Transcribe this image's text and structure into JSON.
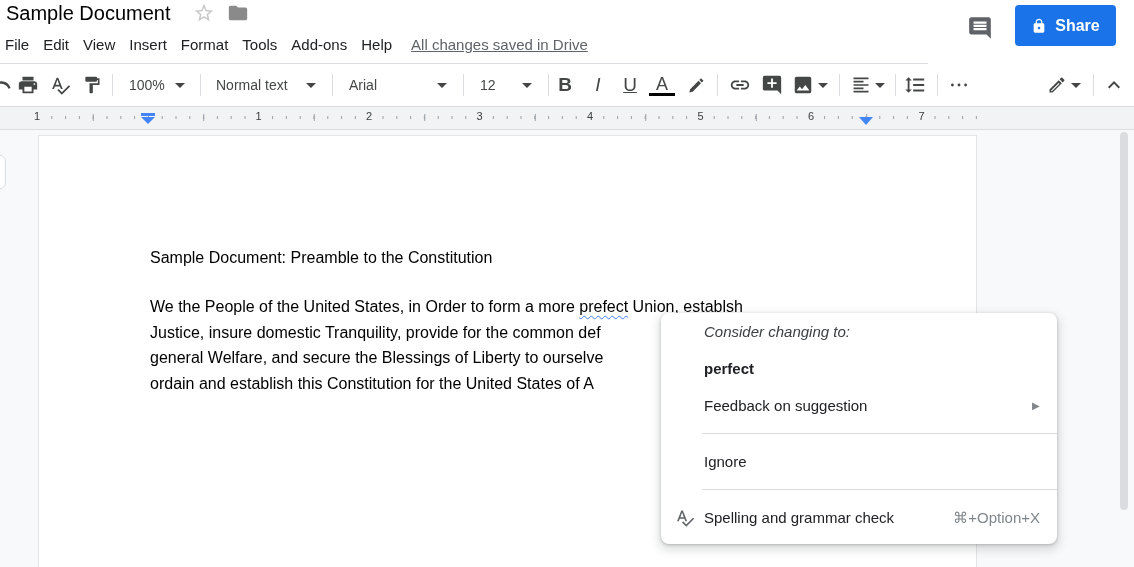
{
  "document_title": "Sample Document",
  "starred": false,
  "menu_bar": [
    "File",
    "Edit",
    "View",
    "Insert",
    "Format",
    "Tools",
    "Add-ons",
    "Help"
  ],
  "save_status": "All changes saved in Drive",
  "share_button": "Share",
  "toolbar": {
    "zoom": "100%",
    "style": "Normal text",
    "font": "Arial",
    "font_size": "12",
    "format_glyphs": [
      "B",
      "I",
      "U"
    ],
    "text_color_glyph": "A"
  },
  "ruler": {
    "labels": [
      "1",
      "1",
      "2",
      "3",
      "4",
      "5",
      "6",
      "7"
    ]
  },
  "document": {
    "heading": "Sample Document: Preamble to the Constitution",
    "paragraph_lines": [
      [
        {
          "text": "We the People of the United States, in Order to form a more "
        },
        {
          "text": "prefect",
          "misspelled": true
        },
        {
          "text": " Union, establsh"
        }
      ],
      [
        {
          "text": "Justice, insure domestic Tranquility, provide for the common def"
        }
      ],
      [
        {
          "text": "general Welfare, and secure the Blessings of Liberty to ourselve"
        }
      ],
      [
        {
          "text": "ordain and establish this Constitution for the United States of A"
        }
      ]
    ]
  },
  "suggestion_menu": {
    "header": "Consider changing to:",
    "sections": [
      [
        {
          "kind": "suggestion",
          "label": "perfect"
        },
        {
          "kind": "submenu",
          "label": "Feedback on suggestion",
          "arrow": "▶"
        }
      ],
      [
        {
          "kind": "action",
          "label": "Ignore"
        }
      ],
      [
        {
          "kind": "tool",
          "label": "Spelling and grammar check",
          "shortcut": "⌘+Option+X"
        }
      ]
    ]
  }
}
